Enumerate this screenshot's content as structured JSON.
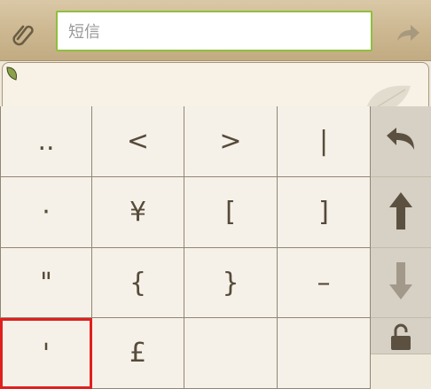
{
  "compose": {
    "placeholder": "短信"
  },
  "keyboard": {
    "keys": [
      "..",
      "<",
      ">",
      "|",
      "·",
      "¥",
      "[",
      "]",
      "\"",
      "{",
      "}",
      "–",
      "'",
      "£",
      "",
      ""
    ],
    "side": [
      {
        "icon": "undo-arrow-icon"
      },
      {
        "icon": "arrow-up-icon"
      },
      {
        "icon": "arrow-down-icon"
      },
      {
        "icon": "unlock-icon"
      }
    ]
  },
  "colors": {
    "selected_border": "#e0201e",
    "input_border": "#8fbf3e",
    "bar": "#cdb892"
  }
}
